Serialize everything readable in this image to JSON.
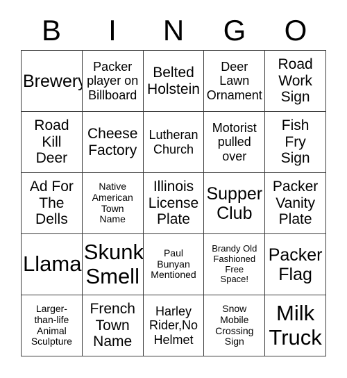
{
  "header": {
    "letters": [
      "B",
      "I",
      "N",
      "G",
      "O"
    ]
  },
  "grid": {
    "columns": 5,
    "rows": 5,
    "border_color": "#3a3a3a",
    "background": "#ffffff",
    "text_color": "#000000",
    "cells": [
      {
        "text": "Brewery",
        "size": "fs-lg"
      },
      {
        "text": "Packer\nplayer on\nBillboard",
        "size": "fs-sm"
      },
      {
        "text": "Belted\nHolstein",
        "size": "fs-md"
      },
      {
        "text": "Deer\nLawn\nOrnament",
        "size": "fs-sm"
      },
      {
        "text": "Road\nWork\nSign",
        "size": "fs-md"
      },
      {
        "text": "Road\nKill\nDeer",
        "size": "fs-md"
      },
      {
        "text": "Cheese\nFactory",
        "size": "fs-md"
      },
      {
        "text": "Lutheran\nChurch",
        "size": "fs-sm"
      },
      {
        "text": "Motorist\npulled\nover",
        "size": "fs-sm"
      },
      {
        "text": "Fish\nFry\nSign",
        "size": "fs-md"
      },
      {
        "text": "Ad For\nThe\nDells",
        "size": "fs-md"
      },
      {
        "text": "Native\nAmerican\nTown\nName",
        "size": "fs-xs"
      },
      {
        "text": "Illinois\nLicense\nPlate",
        "size": "fs-md"
      },
      {
        "text": "Supper\nClub",
        "size": "fs-lg"
      },
      {
        "text": "Packer\nVanity\nPlate",
        "size": "fs-md"
      },
      {
        "text": "Llama",
        "size": "fs-xl"
      },
      {
        "text": "Skunk\nSmell",
        "size": "fs-xl"
      },
      {
        "text": "Paul\nBunyan\nMentioned",
        "size": "fs-xs"
      },
      {
        "text": "Brandy Old\nFashioned\nFree\nSpace!",
        "size": "fs-xxs"
      },
      {
        "text": "Packer\nFlag",
        "size": "fs-lg"
      },
      {
        "text": "Larger-\nthan-life\nAnimal\nSculpture",
        "size": "fs-xs"
      },
      {
        "text": "French\nTown\nName",
        "size": "fs-md"
      },
      {
        "text": "Harley\nRider,No\nHelmet",
        "size": "fs-sm"
      },
      {
        "text": "Snow\nMobile\nCrossing\nSign",
        "size": "fs-xs"
      },
      {
        "text": "Milk\nTruck",
        "size": "fs-xl"
      }
    ]
  }
}
